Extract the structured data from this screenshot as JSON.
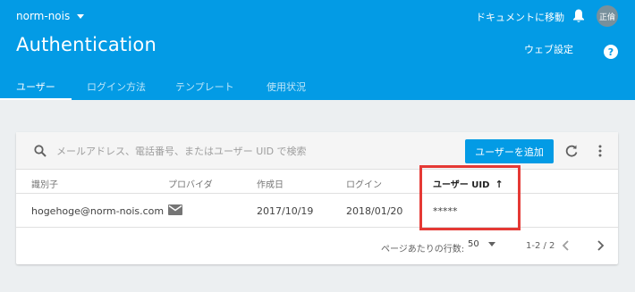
{
  "header": {
    "project_name": "norm-nois",
    "docs_link": "ドキュメントに移動",
    "avatar_text": "正倫",
    "title": "Authentication",
    "web_setup": "ウェブ設定",
    "help_glyph": "?",
    "tabs": [
      {
        "label": "ユーザー",
        "active": true
      },
      {
        "label": "ログイン方法",
        "active": false
      },
      {
        "label": "テンプレート",
        "active": false
      },
      {
        "label": "使用状況",
        "active": false
      }
    ]
  },
  "toolbar": {
    "search_placeholder": "メールアドレス、電話番号、またはユーザー UID で検索",
    "add_user_label": "ユーザーを追加"
  },
  "table": {
    "columns": [
      "識別子",
      "プロバイダ",
      "作成日",
      "ログイン",
      "ユーザー UID"
    ],
    "sort_arrow": "↑",
    "rows": [
      {
        "identifier": "hogehoge@norm-nois.com",
        "provider_icon": "mail-icon",
        "created": "2017/10/19",
        "login": "2018/01/20",
        "uid": "*****"
      }
    ]
  },
  "pagination": {
    "rows_per_page_label": "ページあたりの行数:",
    "rows_per_page_value": "50",
    "range": "1-2 / 2"
  },
  "colors": {
    "header_bg": "#039be5",
    "page_bg": "#eceff1",
    "highlight": "#e53935"
  }
}
